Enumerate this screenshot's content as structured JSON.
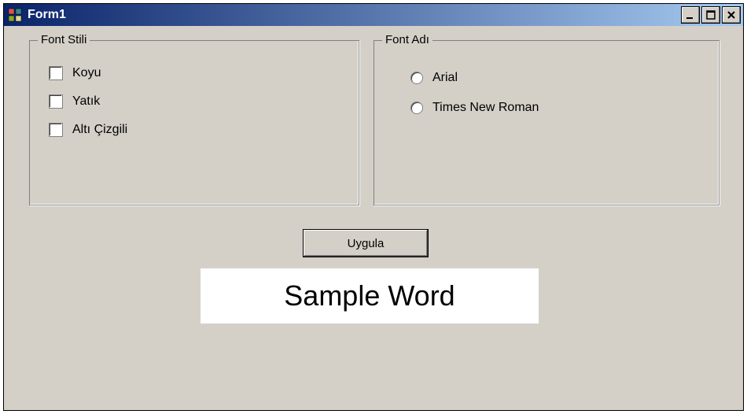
{
  "window": {
    "title": "Form1"
  },
  "groups": {
    "style": {
      "legend": "Font Stili",
      "items": [
        {
          "label": "Koyu"
        },
        {
          "label": "Yatık"
        },
        {
          "label": "Altı Çizgili"
        }
      ]
    },
    "name": {
      "legend": "Font Adı",
      "items": [
        {
          "label": "Arial"
        },
        {
          "label": "Times New Roman"
        }
      ]
    }
  },
  "buttons": {
    "apply": "Uygula"
  },
  "sample": {
    "text": "Sample Word"
  }
}
